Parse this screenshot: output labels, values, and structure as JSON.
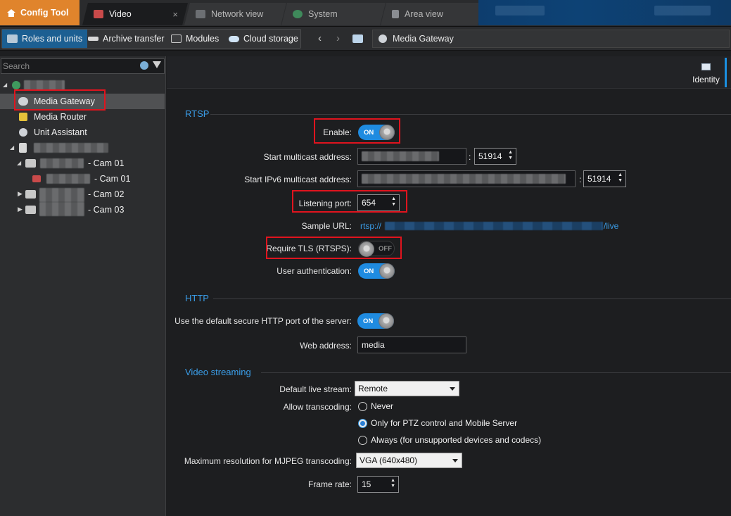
{
  "app_tab": {
    "label": "Config Tool",
    "icon": "home-icon"
  },
  "tabs": [
    {
      "label": "Video",
      "icon": "video-icon",
      "active": true,
      "close": "×"
    },
    {
      "label": "Network view",
      "icon": "network-icon",
      "active": false
    },
    {
      "label": "System",
      "icon": "system-icon",
      "active": false
    },
    {
      "label": "Area view",
      "icon": "area-view-icon",
      "active": false
    }
  ],
  "toolbar": {
    "buttons": [
      {
        "label": "Roles and units",
        "icon": "roles-units-icon",
        "selected": true
      },
      {
        "label": "Archive transfer",
        "icon": "archive-transfer-icon"
      },
      {
        "label": "Modules",
        "icon": "modules-icon"
      },
      {
        "label": "Cloud storage",
        "icon": "cloud-storage-icon"
      }
    ],
    "back": "‹",
    "forward": "›",
    "breadcrumb": {
      "label": "Media Gateway",
      "icon": "media-gateway-icon"
    }
  },
  "left_panel": {
    "search_placeholder": "Search",
    "tree": [
      {
        "label": "Media Gateway",
        "icon": "media-gateway-icon",
        "selected": true
      },
      {
        "label": "Media Router",
        "icon": "media-router-icon"
      },
      {
        "label": "Unit Assistant",
        "icon": "unit-assistant-icon"
      },
      {
        "label": "- Cam 01",
        "icon": "encoder-icon"
      },
      {
        "label": "- Cam 01",
        "icon": "camera-icon"
      },
      {
        "label": "- Cam 02",
        "icon": "encoder-icon"
      },
      {
        "label": "- Cam 03",
        "icon": "encoder-icon"
      }
    ]
  },
  "identity": {
    "label": "Identity"
  },
  "rtsp": {
    "section_title": "RTSP",
    "enable_label": "Enable:",
    "enable_state": "ON",
    "multicast_label": "Start multicast address:",
    "multicast_port": "51914",
    "ipv6_label": "Start IPv6 multicast address:",
    "ipv6_port": "51914",
    "listening_port_label": "Listening port:",
    "listening_port": "654",
    "sample_url_label": "Sample URL:",
    "sample_url_prefix": "rtsp://",
    "sample_url_suffix": "/live",
    "tls_label": "Require TLS (RTSPS):",
    "tls_state": "OFF",
    "auth_label": "User authentication:",
    "auth_state": "ON"
  },
  "http": {
    "section_title": "HTTP",
    "default_port_label": "Use the default secure HTTP port of the server:",
    "default_port_state": "ON",
    "web_address_label": "Web address:",
    "web_address": "media"
  },
  "video_streaming": {
    "section_title": "Video streaming",
    "default_stream_label": "Default live stream:",
    "default_stream": "Remote",
    "transcoding_label": "Allow transcoding:",
    "transcoding_options": [
      {
        "label": "Never",
        "checked": false
      },
      {
        "label": "Only for PTZ control and Mobile Server",
        "checked": true
      },
      {
        "label": "Always (for unsupported devices and codecs)",
        "checked": false
      }
    ],
    "max_res_label": "Maximum resolution for MJPEG transcoding:",
    "max_res": "VGA (640x480)",
    "frame_rate_label": "Frame rate:",
    "frame_rate": "15"
  },
  "colors": {
    "accent": "#1f8be0",
    "section_title": "#3a9de8",
    "highlight_box": "#e0141e",
    "app_tab": "#e0842c"
  }
}
